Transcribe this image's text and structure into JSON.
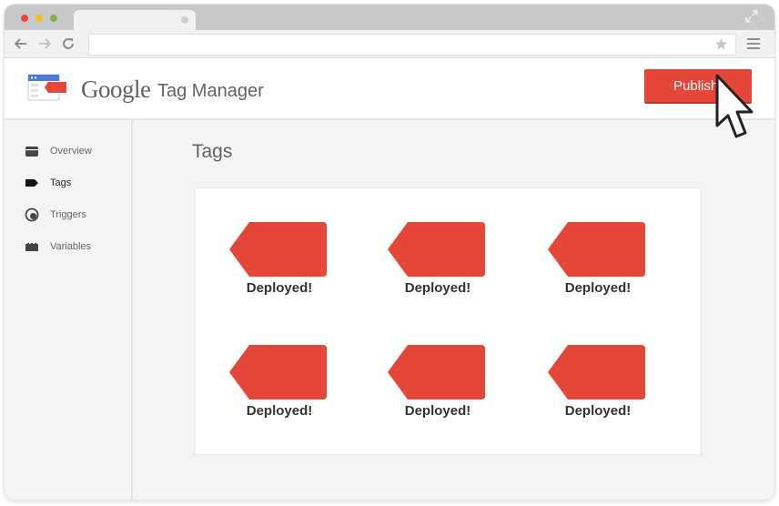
{
  "app": {
    "brand_google": "Google",
    "brand_product": "Tag Manager",
    "publish_label": "Publish"
  },
  "sidebar": {
    "items": [
      {
        "label": "Overview",
        "icon": "overview-icon"
      },
      {
        "label": "Tags",
        "icon": "tag-icon"
      },
      {
        "label": "Triggers",
        "icon": "trigger-icon"
      },
      {
        "label": "Variables",
        "icon": "variables-icon"
      }
    ],
    "active": "Tags"
  },
  "main": {
    "title": "Tags",
    "tags": [
      {
        "status": "Deployed!"
      },
      {
        "status": "Deployed!"
      },
      {
        "status": "Deployed!"
      },
      {
        "status": "Deployed!"
      },
      {
        "status": "Deployed!"
      },
      {
        "status": "Deployed!"
      }
    ]
  },
  "colors": {
    "accent": "#e4473a",
    "tag": "#e4473a",
    "chrome": "#c9c9cc",
    "sidebar": "#f4f4f5"
  }
}
